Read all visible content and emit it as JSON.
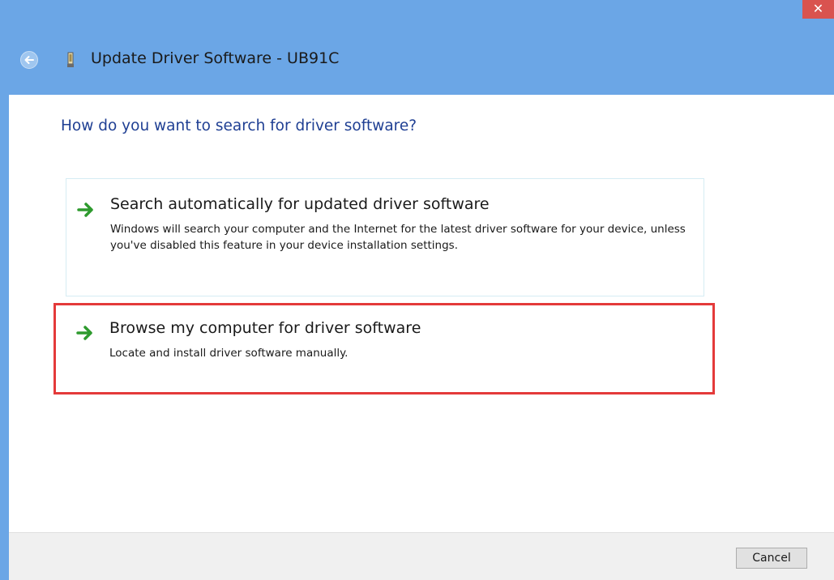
{
  "window": {
    "title": "Update Driver Software - UB91C",
    "close_label": "✕"
  },
  "content": {
    "question": "How do you want to search for driver software?",
    "options": [
      {
        "title": "Search automatically for updated driver software",
        "description": "Windows will search your computer and the Internet for the latest driver software for your device, unless you've disabled this feature in your device installation settings."
      },
      {
        "title": "Browse my computer for driver software",
        "description": "Locate and install driver software manually.",
        "highlighted": true
      }
    ]
  },
  "footer": {
    "cancel_label": "Cancel"
  },
  "icons": {
    "back": "back-arrow-icon",
    "device": "usb-device-icon",
    "option_arrow": "green-arrow-icon"
  },
  "colors": {
    "title_bar": "#6ba6e6",
    "question_text": "#1f3f93",
    "highlight_border": "#e43a3a",
    "arrow_green": "#2e9a2e",
    "close_button": "#d9534f"
  }
}
